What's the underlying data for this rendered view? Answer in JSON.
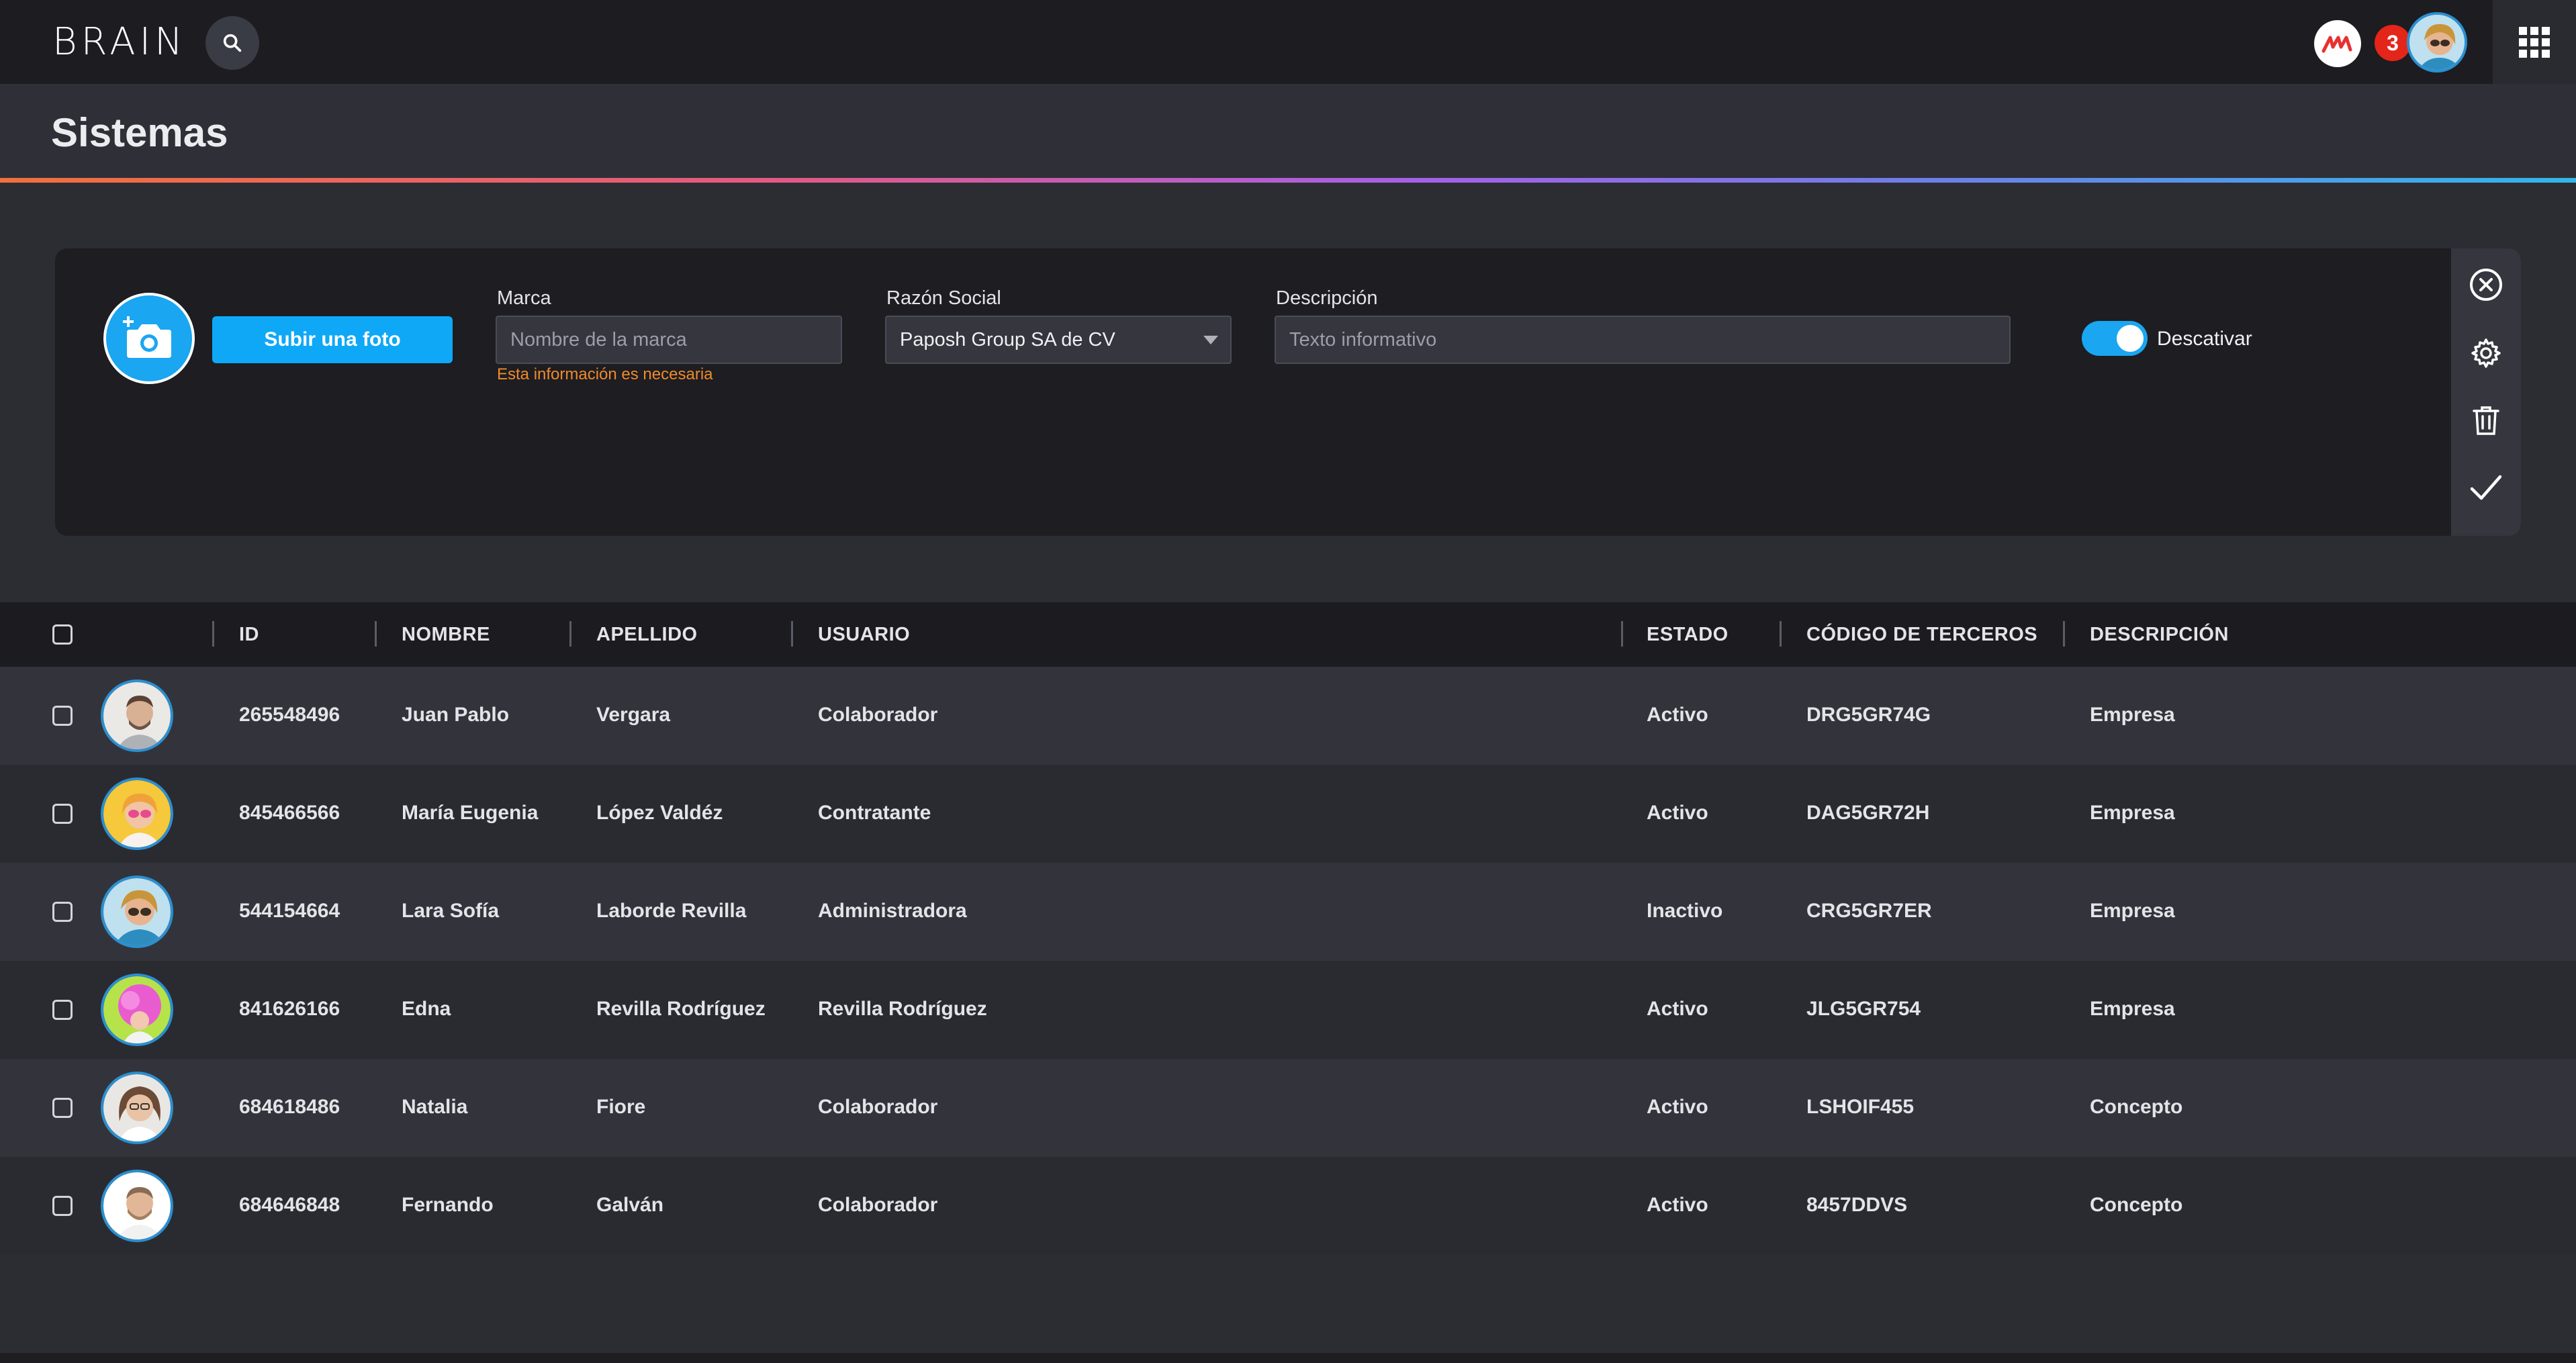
{
  "app": {
    "logo": "BRAIN",
    "notification_count": "3"
  },
  "page": {
    "title": "Sistemas"
  },
  "form": {
    "upload_label": "Subir una foto",
    "marca": {
      "label": "Marca",
      "placeholder": "Nombre de la marca",
      "hint": "Esta información es necesaria"
    },
    "razon_social": {
      "label": "Razón Social",
      "value": "Paposh Group SA de CV"
    },
    "descripcion": {
      "label": "Descripción",
      "placeholder": "Texto informativo"
    },
    "toggle": {
      "label": "Descativar",
      "on": true
    }
  },
  "table": {
    "headers": {
      "id": "ID",
      "nombre": "NOMBRE",
      "apellido": "APELLIDO",
      "usuario": "USUARIO",
      "estado": "ESTADO",
      "codigo": "CÓDIGO DE TERCEROS",
      "descripcion": "DESCRIPCIÓN"
    },
    "rows": [
      {
        "id": "265548496",
        "nombre": "Juan Pablo",
        "apellido": "Vergara",
        "usuario": "Colaborador",
        "estado": "Activo",
        "codigo": "DRG5GR74G",
        "descripcion": "Empresa"
      },
      {
        "id": "845466566",
        "nombre": "María Eugenia",
        "apellido": "López Valdéz",
        "usuario": "Contratante",
        "estado": "Activo",
        "codigo": "DAG5GR72H",
        "descripcion": "Empresa"
      },
      {
        "id": "544154664",
        "nombre": "Lara Sofía",
        "apellido": "Laborde Revilla",
        "usuario": "Administradora",
        "estado": "Inactivo",
        "codigo": "CRG5GR7ER",
        "descripcion": "Empresa"
      },
      {
        "id": "841626166",
        "nombre": "Edna",
        "apellido": "Revilla Rodríguez",
        "usuario": "Revilla Rodríguez",
        "estado": "Activo",
        "codigo": "JLG5GR754",
        "descripcion": "Empresa"
      },
      {
        "id": "684618486",
        "nombre": "Natalia",
        "apellido": "Fiore",
        "usuario": "Colaborador",
        "estado": "Activo",
        "codigo": "LSHOIF455",
        "descripcion": "Concepto"
      },
      {
        "id": "684646848",
        "nombre": "Fernando",
        "apellido": "Galván",
        "usuario": "Colaborador",
        "estado": "Activo",
        "codigo": "8457DDVS",
        "descripcion": "Concepto"
      }
    ]
  },
  "colors": {
    "accent": "#1aa6f1",
    "hint": "#f08a2a",
    "badge": "#e3251a"
  }
}
